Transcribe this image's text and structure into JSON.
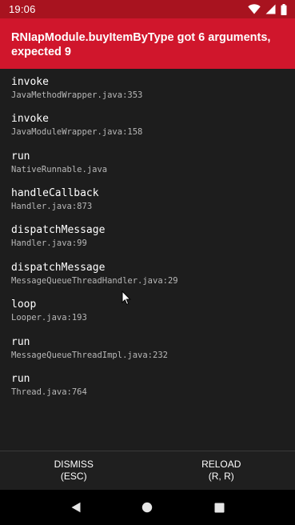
{
  "status_bar": {
    "time": "19:06",
    "icons": [
      "wifi-icon",
      "cell-signal-icon",
      "battery-icon"
    ]
  },
  "error": {
    "message": "RNIapModule.buyItemByType got 6 arguments, expected 9"
  },
  "stack_frames": [
    {
      "method": "invoke",
      "file": "JavaMethodWrapper.java:353"
    },
    {
      "method": "invoke",
      "file": "JavaModuleWrapper.java:158"
    },
    {
      "method": "run",
      "file": "NativeRunnable.java"
    },
    {
      "method": "handleCallback",
      "file": "Handler.java:873"
    },
    {
      "method": "dispatchMessage",
      "file": "Handler.java:99"
    },
    {
      "method": "dispatchMessage",
      "file": "MessageQueueThreadHandler.java:29"
    },
    {
      "method": "loop",
      "file": "Looper.java:193"
    },
    {
      "method": "run",
      "file": "MessageQueueThreadImpl.java:232"
    },
    {
      "method": "run",
      "file": "Thread.java:764"
    }
  ],
  "footer": {
    "dismiss_line1": "DISMISS",
    "dismiss_line2": "(ESC)",
    "reload_line1": "RELOAD",
    "reload_line2": "(R, R)"
  },
  "nav": {
    "icons": [
      "back-icon",
      "home-icon",
      "recents-icon"
    ]
  },
  "colors": {
    "status_bar": "#a8131f",
    "error_header": "#d0162c",
    "background": "#1d1d1d",
    "nav_bar": "#000000"
  }
}
